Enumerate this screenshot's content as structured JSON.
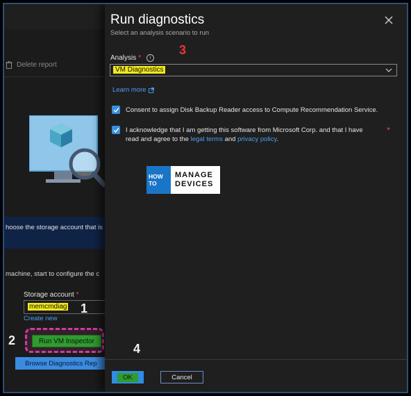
{
  "background": {
    "toolbar": {
      "delete_label": "Delete report"
    },
    "banner_text": "hoose the storage account that is",
    "config_text": "machine, start to configure the c",
    "storage": {
      "label": "Storage account",
      "required_mark": "*",
      "value": "memcmdiag",
      "create_new": "Create new"
    },
    "run_button": "Run VM Inspector",
    "browse_button": "Browse Diagnostics Rep"
  },
  "panel": {
    "title": "Run diagnostics",
    "subtitle": "Select an analysis scenario to run",
    "analysis": {
      "label": "Analysis",
      "required_mark": "*",
      "value": "VM Diagnostics"
    },
    "learn_more": "Learn more",
    "consent_text": "Consent to assign Disk Backup Reader access to Compute Recommendation Service.",
    "ack": {
      "line1": "I acknowledge that I am getting this software from Microsoft Corp. and that I have",
      "line2_prefix": "read and agree to the",
      "legal_terms": "legal terms",
      "and": "and",
      "privacy_policy": "privacy policy",
      "suffix": ".",
      "required_mark": "*"
    },
    "logo": {
      "left_top": "HOW",
      "left_bottom": "TO",
      "right_top": "MANAGE",
      "right_bottom": "DEVICES"
    },
    "ok_button": "OK",
    "cancel_button": "Cancel"
  },
  "annotations": {
    "one": "1",
    "two": "2",
    "three": "3",
    "four": "4"
  },
  "icons": {
    "close": "close-icon",
    "chevron": "chevron-down-icon",
    "info": "info-icon",
    "external": "external-link-icon",
    "trash": "trash-icon",
    "checkbox": "checkmark-icon"
  },
  "colors": {
    "accent": "#3a8fde",
    "link": "#4aa0f0",
    "highlight_yellow": "#f2ea1a",
    "highlight_green": "#2e9c2e",
    "required": "#f05454",
    "annotation_red": "#e33333",
    "dashed_box": "#d23c9c"
  }
}
